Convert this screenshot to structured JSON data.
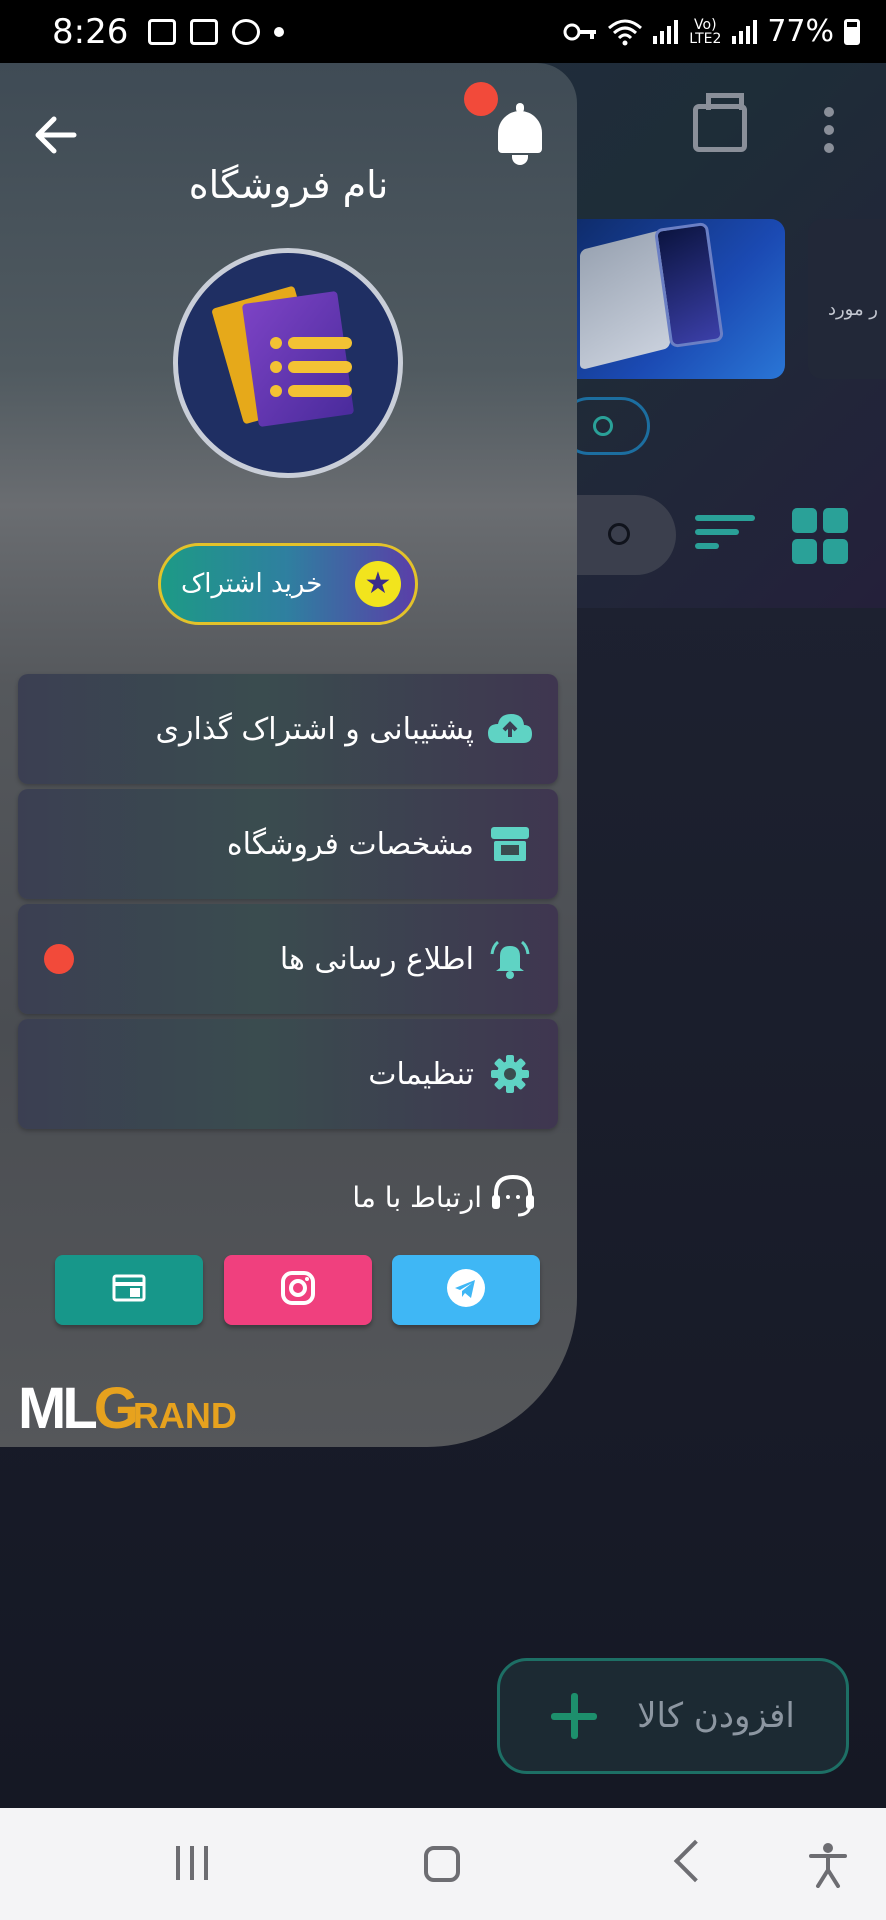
{
  "status_bar": {
    "time": "8:26",
    "battery": "77%",
    "network": "Vo) LTE2"
  },
  "drawer": {
    "store_name": "نام فروشگاه",
    "subscribe_button": "خرید اشتراک",
    "menu": [
      {
        "label": "پشتیبانی و اشتراک گذاری",
        "icon": "cloud-upload-icon"
      },
      {
        "label": "مشخصات فروشگاه",
        "icon": "store-icon"
      },
      {
        "label": "اطلاع رسانی ها",
        "icon": "notification-ring-icon",
        "has_badge": true
      },
      {
        "label": "تنظیمات",
        "icon": "gear-icon"
      }
    ],
    "contact_title": "ارتباط با ما",
    "social": [
      {
        "name": "telegram",
        "icon": "telegram-icon",
        "color": "#3fb7f5"
      },
      {
        "name": "instagram",
        "icon": "instagram-icon",
        "color": "#f0407e"
      },
      {
        "name": "website",
        "icon": "web-icon",
        "color": "#17978a"
      }
    ],
    "brand": {
      "part1": "ML",
      "part2": "G",
      "part3": "RAND"
    }
  },
  "background": {
    "add_product_label": "افزودن کالا",
    "card_text": "ر مورد"
  },
  "colors": {
    "accent_teal": "#2aa198",
    "badge_red": "#f24a3a",
    "subscribe_border": "#e3c22a"
  }
}
